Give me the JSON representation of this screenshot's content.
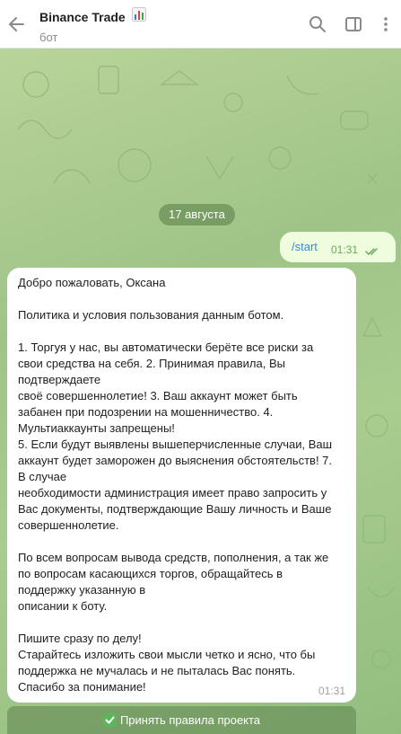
{
  "header": {
    "title": "Binance Trade",
    "subtitle": "бот",
    "title_emoji": "chart-icon"
  },
  "chat": {
    "date_separator": "17 августа",
    "outgoing": {
      "text": "/start",
      "time": "01:31",
      "status": "read"
    },
    "incoming": {
      "text": "Добро пожаловать, Оксана\n\nПолитика и условия пользования данным ботом.\n\n1. Торгуя у нас, вы автоматически берёте все риски за\nсвои средства на себя. 2. Принимая правила, Вы\nподтверждаете\nсвоё совершеннолетие! 3. Ваш аккаунт может быть\nзабанен при подозрении на мошенничество. 4.\nМультиаккаунты запрещены!\n5. Если будут выявлены вышеперчисленные случаи, Ваш\nаккаунт будет заморожен до выяснения обстоятельств! 7.\nВ случае\nнеобходимости администрация имеет право запросить у\nВас документы, подтверждающие Вашу личность и Ваше\nсовершеннолетие.\n\nПо всем вопросам вывода средств, пополнения, а так же\nпо вопросам касающихся торгов, обращайтесь в\nподдержку указанную в\nописании к боту.\n\nПишите сразу по делу!\nСтарайтесь изложить свои мысли четко и ясно, что бы\nподдержка не мучалась и не пыталась Вас понять.\nСпасибо за понимание!",
      "time": "01:31"
    }
  },
  "keyboard": {
    "accept_button": "Принять правила проекта",
    "accept_icon": "check-mark-button-icon"
  },
  "colors": {
    "outgoing_bubble": "#effdde",
    "incoming_bubble": "#ffffff",
    "command_link": "#3a8bd8"
  }
}
